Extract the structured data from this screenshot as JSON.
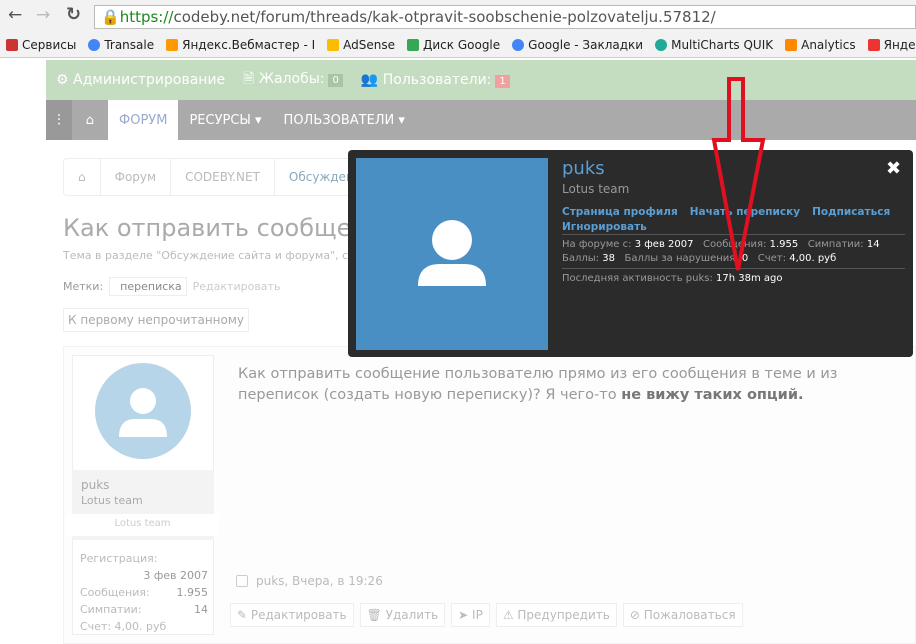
{
  "browser": {
    "url_scheme": "https://",
    "url_rest": "codeby.net/forum/threads/kak-otpravit-soobschenie-polzovatelju.57812/",
    "bookmarks": [
      "Сервисы",
      "Transale",
      "Яндекс.Вебмастер - I",
      "AdSense",
      "Диск Google",
      "Google - Закладки",
      "MultiCharts QUIK",
      "Analytics",
      "Яндекс.Мет"
    ]
  },
  "adminbar": {
    "admin": "Администрирование",
    "complaints": "Жалобы:",
    "complaints_count": "0",
    "users": "Пользователи:",
    "users_count": "1"
  },
  "nav": {
    "tabs": [
      "ФОРУМ",
      "РЕСУРСЫ ▾",
      "ПОЛЬЗОВАТЕЛИ ▾"
    ]
  },
  "breadcrumb": [
    "Форум",
    "CODEBY.NET",
    "Обсуждение"
  ],
  "thread": {
    "title": "Как отправить сообщение пользователю",
    "subtitle": "Тема в разделе \"Обсуждение сайта и форума\", с",
    "tags_label": "Метки:",
    "tag": "переписка",
    "edit_tags": "Редактировать",
    "first_unread": "К первому непрочитанному"
  },
  "post": {
    "username": "puks",
    "usertitle": "Lotus team",
    "banner": "Lotus team",
    "reg_label": "Регистрация:",
    "reg_value": "3 фев 2007",
    "msgs_label": "Сообщения:",
    "msgs_value": "1.955",
    "likes_label": "Симпатии:",
    "likes_value": "14",
    "account": "Счет: 4,00. руб",
    "text_a": "Как отправить сообщение пользователю прямо из его сообщения в теме и из переписок (создать новую переписку)? Я чего-то ",
    "text_b": "не вижу таких опций.",
    "meta": "puks, Вчера, в 19:26",
    "actions": [
      "✎ Редактировать",
      "🗑 Удалить",
      "➤ IP",
      "⚠ Предупредить",
      "⊘ Пожаловаться"
    ]
  },
  "popup": {
    "name": "puks",
    "title": "Lotus team",
    "links": [
      "Страница профиля",
      "Начать переписку",
      "Подписаться",
      "Игнорировать"
    ],
    "since_label": "На форуме с:",
    "since": "3 фев 2007",
    "msgs_label": "Сообщения:",
    "msgs": "1.955",
    "likes_label": "Симпатии:",
    "likes": "14",
    "points_label": "Баллы:",
    "points": "38",
    "warn_label": "Баллы за нарушения:",
    "warn": "0",
    "acct_label": "Счет:",
    "acct": "4,00. руб",
    "last_label": "Последняя активность puks:",
    "last": "17h 38m ago"
  },
  "colors": {
    "admin_bar": "#c4dcc0",
    "nav_bar": "#aaaaaa",
    "popup_bg": "#2b2b2b",
    "link": "#5a9fd4",
    "avatar_blue": "#4a8fc3",
    "arrow": "#e01020"
  }
}
